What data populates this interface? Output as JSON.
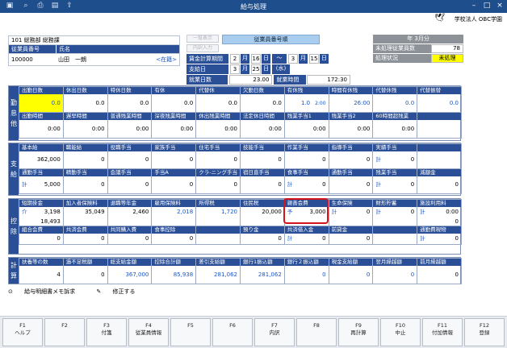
{
  "window": {
    "title": "給与処理"
  },
  "org_name": "学校法人 OBC学園",
  "employee": {
    "department": "101 総務部 総務課",
    "no_label": "従業員番号",
    "name_label": "氏名",
    "no": "100000",
    "name": "山田　一朗",
    "status": "<在籍>"
  },
  "tiny_buttons": [
    "一覧表示",
    "内訳入力"
  ],
  "search_box": "従業員番号順",
  "dates": {
    "calc_label": "賃金計算期間",
    "calc_from_m": "2",
    "calc_from_d": "16",
    "calc_to_m": "3",
    "calc_to_d": "15",
    "pay_label": "支給日",
    "pay_m": "3",
    "pay_d": "25",
    "pay_dow": "(水)",
    "work_days_label": "就業日数",
    "work_days": "23.00",
    "work_hours_label": "就業時間",
    "work_hours": "172:30",
    "tilde": "〜",
    "u_month": "月",
    "u_day": "日"
  },
  "right_info": {
    "year_month": "年 3月分",
    "unprocessed_label": "未処理従業員数",
    "unprocessed": "78",
    "status_label": "処理状況",
    "status": "未処理"
  },
  "attendance": {
    "side": [
      "勤",
      "怠",
      "他"
    ],
    "row1": [
      {
        "l": "出勤日数",
        "v": "0.0",
        "yel": true
      },
      {
        "l": "休出日数",
        "v": "0.0"
      },
      {
        "l": "特休日数",
        "v": "0.0"
      },
      {
        "l": "有休",
        "v": "0.0"
      },
      {
        "l": "代替休",
        "v": "0.0"
      },
      {
        "l": "欠勤日数",
        "v": "0.0"
      },
      {
        "l": "有休残",
        "v": "1.0",
        "s": "2:00",
        "blue": true
      },
      {
        "l": "時間有休残",
        "v": "26:00",
        "blue": true
      },
      {
        "l": "代替休残",
        "v": "0.0",
        "blue": true
      },
      {
        "l": "代替振替",
        "v": "0.0",
        "blue": true
      }
    ],
    "row2": [
      {
        "l": "出勤時間",
        "v": "0:00"
      },
      {
        "l": "遅早時間",
        "v": "0:00"
      },
      {
        "l": "普通残業時間",
        "v": "0:00"
      },
      {
        "l": "深夜残業時間",
        "v": "0:00"
      },
      {
        "l": "休出残業時間",
        "v": "0:00"
      },
      {
        "l": "法定休日時間",
        "v": "0:00"
      },
      {
        "l": "残業手当1",
        "v": "0:00"
      },
      {
        "l": "残業手当2",
        "v": "0:00"
      },
      {
        "l": "60時間超残業",
        "v": "0:00"
      },
      {
        "l": "",
        "v": ""
      }
    ]
  },
  "pay": {
    "side": [
      "支",
      "給"
    ],
    "row1": [
      {
        "l": "基本給",
        "v": "362,000"
      },
      {
        "l": "職能給",
        "v": "0"
      },
      {
        "l": "役職手当",
        "v": "0"
      },
      {
        "l": "家族手当",
        "v": "0"
      },
      {
        "l": "住宅手当",
        "v": "0"
      },
      {
        "l": "技能手当",
        "v": "0"
      },
      {
        "l": "作業手当",
        "v": "0"
      },
      {
        "l": "指導手当",
        "v": "0"
      },
      {
        "l": "実績手当",
        "v": "0",
        "pfx": "計"
      },
      {
        "l": "",
        "v": ""
      }
    ],
    "row2": [
      {
        "l": "通勤手当",
        "v": "5,000",
        "pfx": "計"
      },
      {
        "l": "精勤手当",
        "v": "0"
      },
      {
        "l": "会議手当",
        "v": "0"
      },
      {
        "l": "手当A",
        "v": "0"
      },
      {
        "l": "クラ-ニング手当",
        "v": "0"
      },
      {
        "l": "宿日直手当",
        "v": "0"
      },
      {
        "l": "食事手当",
        "v": "0",
        "pfx": "計"
      },
      {
        "l": "通勤手当",
        "v": "0"
      },
      {
        "l": "残業手当",
        "v": "0",
        "pfx": "計"
      },
      {
        "l": "減額金",
        "v": "0"
      }
    ]
  },
  "deduct": {
    "side": [
      "控",
      "除"
    ],
    "row1": [
      {
        "l": "短期掛金",
        "v": "3,198",
        "v2": "18,493",
        "pfx": "介"
      },
      {
        "l": "加入者保険料",
        "v": "35,049"
      },
      {
        "l": "退職等年金",
        "v": "2,460"
      },
      {
        "l": "雇用保険料",
        "v": "2,018",
        "blue": true
      },
      {
        "l": "所得税",
        "v": "1,720",
        "blue": true
      },
      {
        "l": "住民税",
        "v": "20,000"
      },
      {
        "l": "親善会費",
        "v": "3,000",
        "pfx": "予"
      },
      {
        "l": "生命保険",
        "v": "0",
        "pfx": "計"
      },
      {
        "l": "財形貯蓄",
        "v": "0",
        "pfx": "計"
      },
      {
        "l": "施設利用料",
        "v": "0:00",
        "v2": "0",
        "pfx": "計"
      }
    ],
    "row2": [
      {
        "l": "組合会費",
        "v": "0"
      },
      {
        "l": "共済会費",
        "v": "0"
      },
      {
        "l": "共同購入費",
        "v": "0"
      },
      {
        "l": "食事控除",
        "v": "0"
      },
      {
        "l": "",
        "v": ""
      },
      {
        "l": "預り金",
        "v": "0"
      },
      {
        "l": "共済借入金",
        "v": "0",
        "pfx": "計"
      },
      {
        "l": "前貸金",
        "v": "0"
      },
      {
        "l": "",
        "v": ""
      },
      {
        "l": "通勤費現物",
        "v": "0",
        "pfx": "計"
      }
    ]
  },
  "calc": {
    "side": [
      "計",
      "算"
    ],
    "row1": [
      {
        "l": "扶養等の数",
        "v": "4"
      },
      {
        "l": "過不足税額",
        "v": "0"
      },
      {
        "l": "総支給金額",
        "v": "367,000",
        "blue": true
      },
      {
        "l": "控除合計額",
        "v": "85,938",
        "blue": true
      },
      {
        "l": "差引支給額",
        "v": "281,062",
        "blue": true
      },
      {
        "l": "銀行1振込額",
        "v": "281,062",
        "blue": true
      },
      {
        "l": "銀行２振込額",
        "v": "0",
        "blue": true
      },
      {
        "l": "現金支給額",
        "v": "0",
        "blue": true
      },
      {
        "l": "翌月繰越額",
        "v": "0",
        "blue": true
      },
      {
        "l": "前月繰越額",
        "v": "0"
      }
    ]
  },
  "links": {
    "memo": "給与明細書メモ訴求",
    "edit": "修正する"
  },
  "fkeys": [
    {
      "k": "F1",
      "t": "ヘルプ"
    },
    {
      "k": "F2",
      "t": ""
    },
    {
      "k": "F3",
      "t": "付箋"
    },
    {
      "k": "F4",
      "t": "従業員情報"
    },
    {
      "k": "F5",
      "t": ""
    },
    {
      "k": "F6",
      "t": ""
    },
    {
      "k": "F7",
      "t": "内訳"
    },
    {
      "k": "F8",
      "t": ""
    },
    {
      "k": "F9",
      "t": "再計算"
    },
    {
      "k": "F10",
      "t": "中止"
    },
    {
      "k": "F11",
      "t": "付加情報"
    },
    {
      "k": "F12",
      "t": "登録"
    }
  ]
}
